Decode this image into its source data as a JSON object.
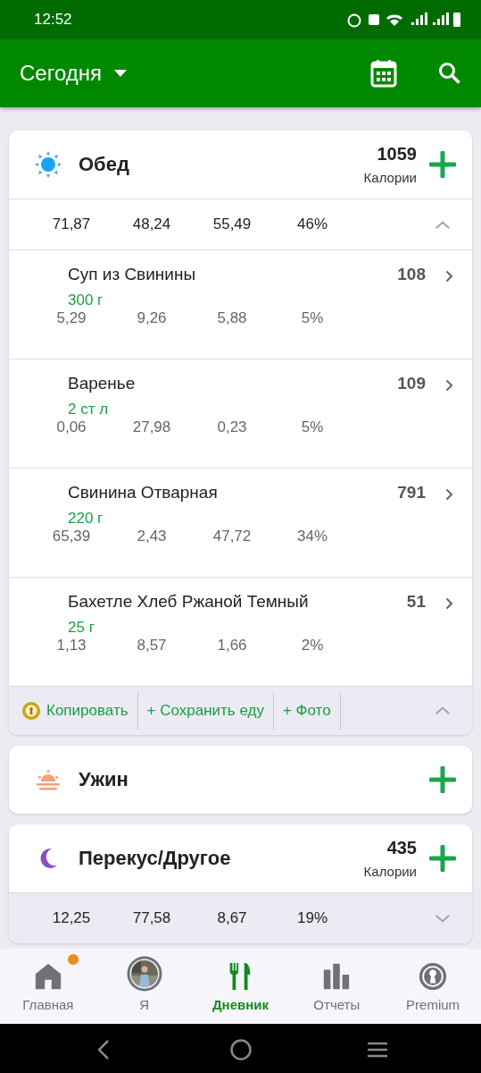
{
  "status_bar": {
    "time": "12:52"
  },
  "app_bar": {
    "title": "Сегодня"
  },
  "meals": [
    {
      "kind": "lunch",
      "name": "Обед",
      "calories": "1059",
      "calories_label": "Калории",
      "totals": [
        "71,87",
        "48,24",
        "55,49",
        "46%"
      ],
      "expanded": true,
      "foods": [
        {
          "name": "Суп из Свинины",
          "amount": "300 г",
          "calories": "108",
          "macros": [
            "5,29",
            "9,26",
            "5,88",
            "5%"
          ]
        },
        {
          "name": "Варенье",
          "amount": "2 ст л",
          "calories": "109",
          "macros": [
            "0,06",
            "27,98",
            "0,23",
            "5%"
          ]
        },
        {
          "name": "Свинина Отварная",
          "amount": "220 г",
          "calories": "791",
          "macros": [
            "65,39",
            "2,43",
            "47,72",
            "34%"
          ]
        },
        {
          "name": "Бахетле Хлеб Ржаной Темный",
          "amount": "25 г",
          "calories": "51",
          "macros": [
            "1,13",
            "8,57",
            "1,66",
            "2%"
          ]
        }
      ],
      "actions": [
        {
          "kind": "premium",
          "label": "Копировать"
        },
        {
          "kind": "plain",
          "label": "+ Сохранить еду"
        },
        {
          "kind": "plain",
          "label": "+ Фото"
        }
      ]
    },
    {
      "kind": "dinner",
      "name": "Ужин"
    },
    {
      "kind": "snack",
      "name": "Перекус/Другое",
      "calories": "435",
      "calories_label": "Калории",
      "totals": [
        "12,25",
        "77,58",
        "8,67",
        "19%"
      ],
      "expanded": false
    }
  ],
  "nav": [
    {
      "kind": "home",
      "label": "Главная",
      "selected": false,
      "badge": true
    },
    {
      "kind": "me",
      "label": "Я",
      "selected": false,
      "badge": false
    },
    {
      "kind": "diary",
      "label": "Дневник",
      "selected": true,
      "badge": false
    },
    {
      "kind": "reports",
      "label": "Отчеты",
      "selected": false,
      "badge": false
    },
    {
      "kind": "premium",
      "label": "Premium",
      "selected": false,
      "badge": false
    }
  ]
}
